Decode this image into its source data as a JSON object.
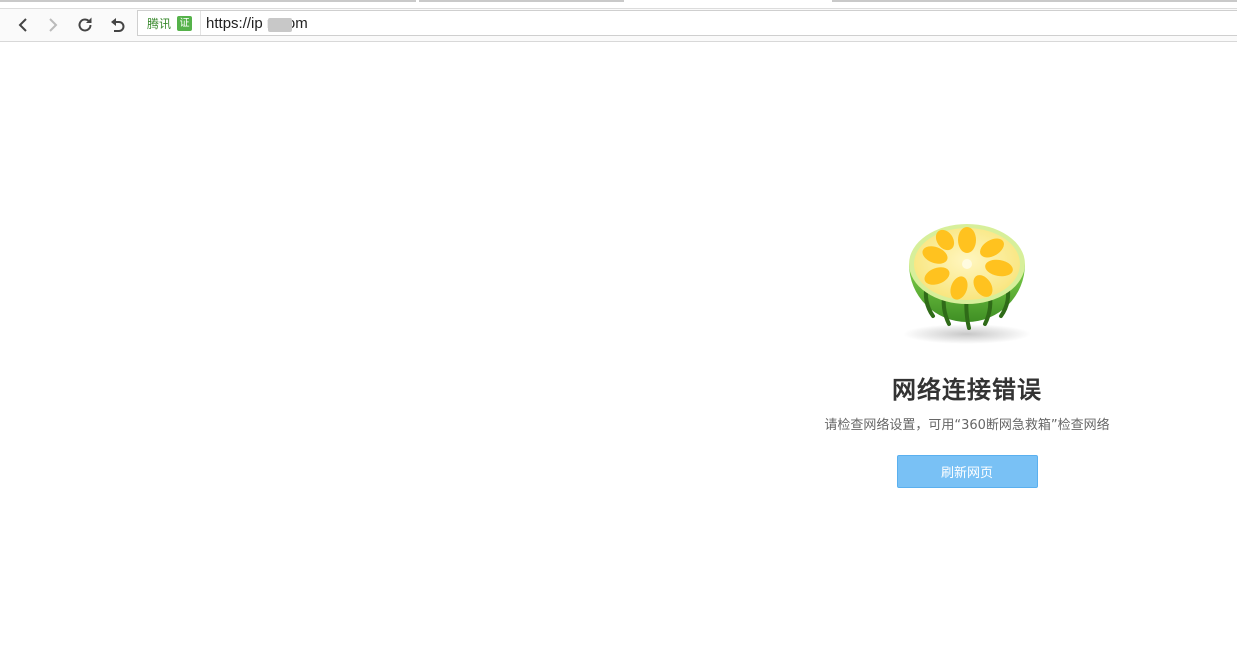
{
  "toolbar": {
    "back_icon": "chevron-left-icon",
    "forward_icon": "chevron-right-icon",
    "reload_icon": "reload-icon",
    "undo_icon": "undo-icon"
  },
  "address": {
    "cert_label": "腾讯",
    "cert_badge": "证",
    "url": "https://ip    n.com"
  },
  "error": {
    "title": "网络连接错误",
    "description": "请检查网络设置，可用“360断网急救箱”检查网络",
    "button_label": "刷新网页"
  },
  "colors": {
    "button": "#79c1f5",
    "cert_green": "#55b24a"
  }
}
